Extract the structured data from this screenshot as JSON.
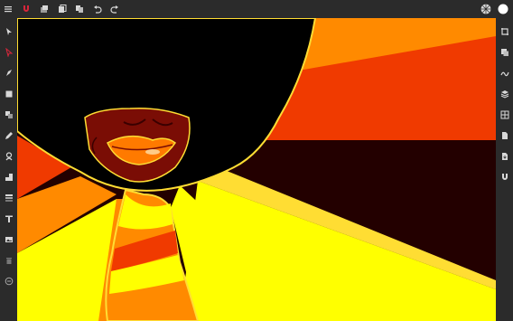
{
  "app": {
    "colors": {
      "chrome": "#2b2b2b",
      "icon": "#d8d8d8",
      "accent_red": "#d9263b",
      "outline_yellow": "#ffdd33"
    }
  },
  "topbar": {
    "left_icons": [
      "menu-icon",
      "magnet-icon",
      "layers-icon",
      "copy-icon",
      "paste-icon",
      "undo-icon",
      "redo-icon"
    ],
    "right_icons": [
      "grid-globe-icon",
      "color-swatch-icon"
    ]
  },
  "left_toolbar": {
    "tools": [
      "select-icon",
      "direct-select-icon",
      "pen-icon",
      "rectangle-icon",
      "boolean-icon",
      "pencil-icon",
      "brush-icon",
      "fill-icon",
      "gradient-icon",
      "text-icon",
      "image-icon",
      "trash-icon",
      "comment-icon"
    ]
  },
  "right_toolbar": {
    "panels": [
      "crop-icon",
      "duplicate-icon",
      "path-icon",
      "layers-stack-icon",
      "grid-icon",
      "document-icon",
      "export-icon",
      "snap-magnet-icon"
    ]
  },
  "canvas": {
    "palette": {
      "bg_dark": "#230000",
      "hair": "#000000",
      "orange": "#ff8a00",
      "red_orange": "#f03a00",
      "yellow": "#ffff00",
      "skin": "#7a0d05",
      "lips": "#ff7a00"
    }
  }
}
